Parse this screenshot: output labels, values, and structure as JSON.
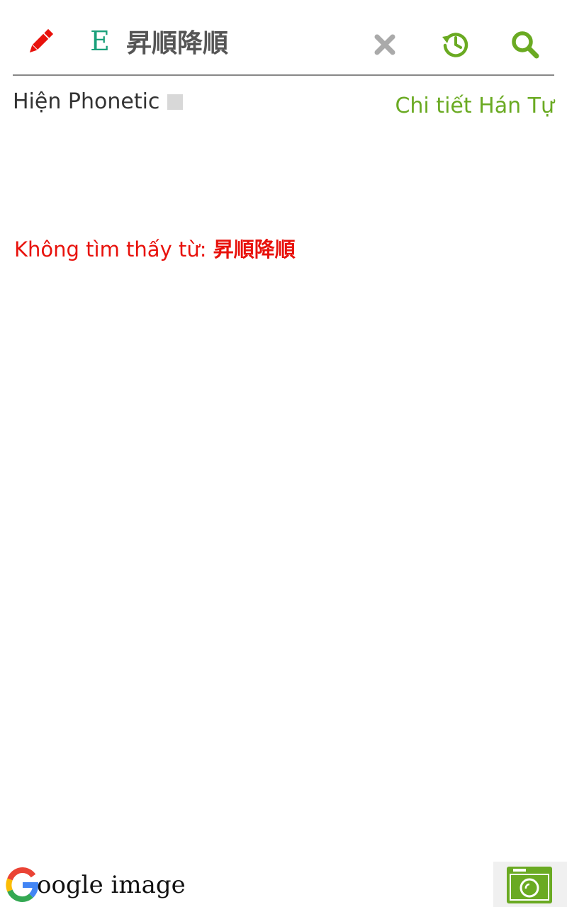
{
  "header": {
    "query": "昇順降順",
    "lang_label": "E",
    "icons": {
      "edit": "pencil-icon",
      "clear": "close-icon",
      "history": "history-icon",
      "search": "search-icon"
    }
  },
  "options": {
    "phonetic_label": "Hiện Phonetic",
    "phonetic_checked": false,
    "hanzi_detail_link": "Chi tiết Hán Tự"
  },
  "result": {
    "not_found_prefix": "Không tìm thấy từ: ",
    "query_word": "昇順降順"
  },
  "footer": {
    "google_image_label": "oogle image",
    "google_logo_letter": "G"
  },
  "colors": {
    "accent_green": "#6aaa22",
    "error_red": "#e8120c",
    "pencil_red": "#e8120c",
    "lang_teal": "#1aa07a",
    "clear_gray": "#aaaaaa"
  }
}
